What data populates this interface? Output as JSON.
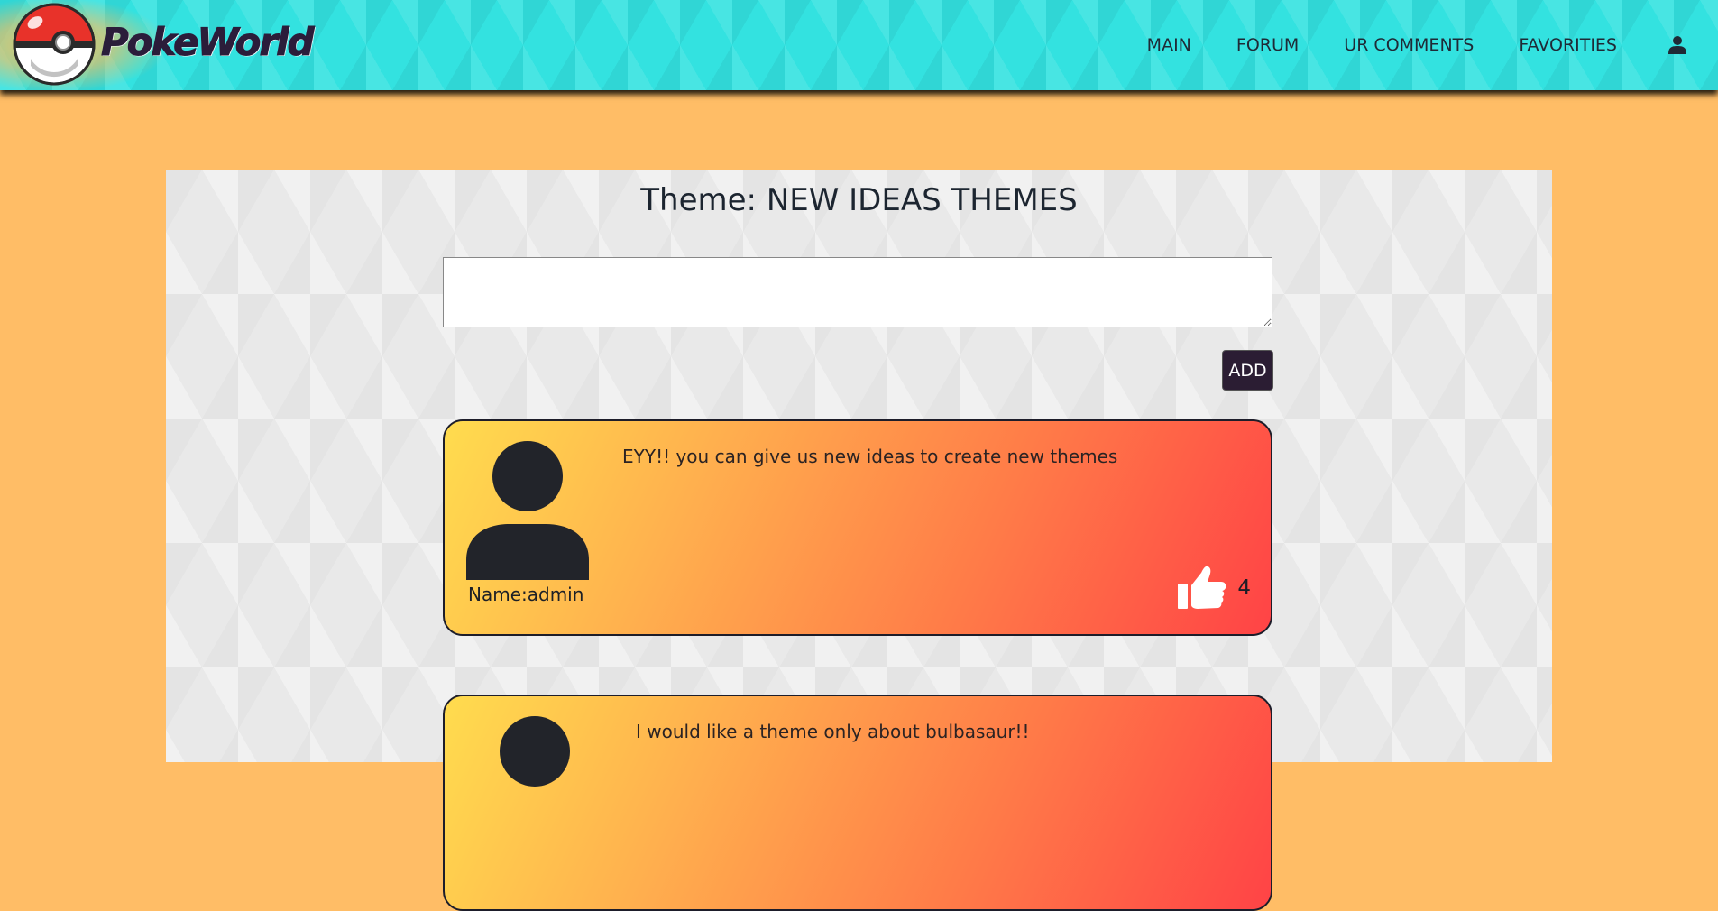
{
  "header": {
    "logo_text": "PokeWorld",
    "nav": [
      {
        "label": "MAIN"
      },
      {
        "label": "FORUM"
      },
      {
        "label": "UR COMMENTS"
      },
      {
        "label": "FAVORITIES"
      }
    ],
    "user_icon": "user-icon"
  },
  "page": {
    "title": "Theme: NEW IDEAS THEMES",
    "comment_input_value": "",
    "add_button_label": "ADD"
  },
  "comments": [
    {
      "author": "Name:admin",
      "text": "EYY!! you can give us new ideas to create new themes",
      "likes": "4",
      "like_icon": "thumbs-up-icon",
      "avatar_icon": "person-silhouette-icon"
    },
    {
      "text": "I would like a theme only about bulbasaur!!",
      "avatar_icon": "person-silhouette-icon"
    }
  ],
  "colors": {
    "page_background": "#ffbd66",
    "navbar": "#33e2e0",
    "content_panel": "#e9e9e9",
    "card_gradient_start": "#ffdc4e",
    "card_gradient_end": "#ff4346",
    "add_button": "#2b1d33",
    "text_dark": "#1c2530"
  }
}
